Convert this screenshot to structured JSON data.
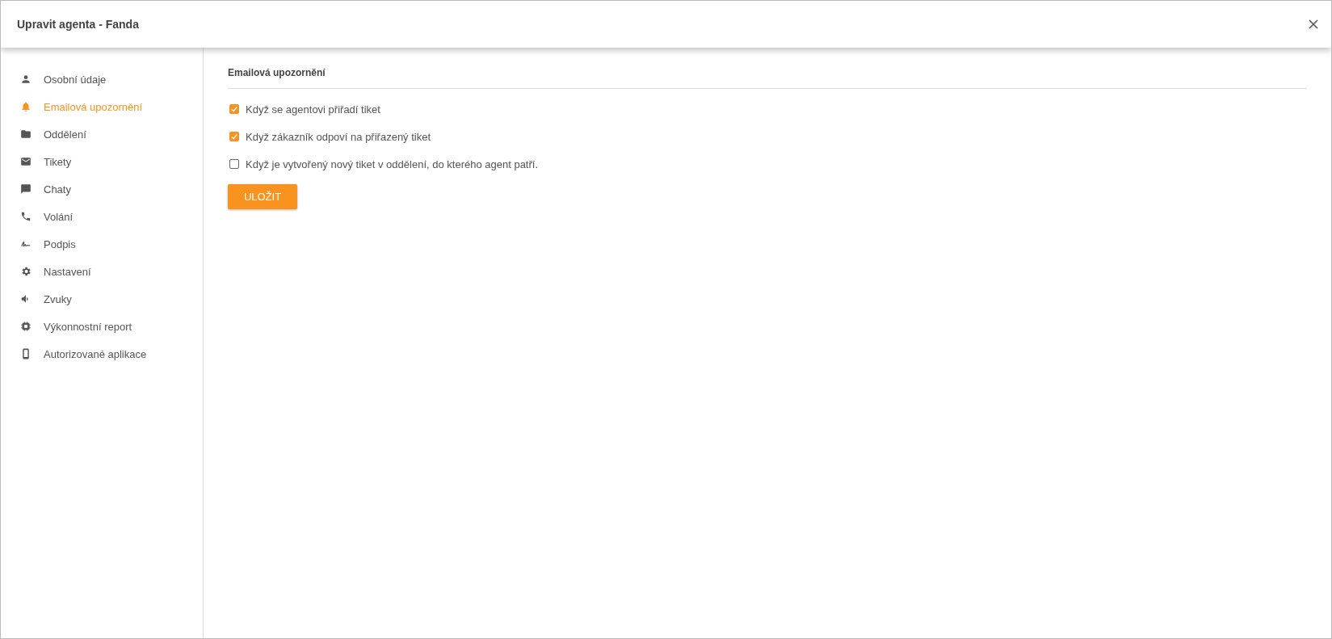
{
  "dialog": {
    "title": "Upravit agenta - Fanda"
  },
  "sidebar": {
    "items": [
      {
        "label": "Osobní údaje",
        "selected": false
      },
      {
        "label": "Emailová upozornění",
        "selected": true
      },
      {
        "label": "Oddělení",
        "selected": false
      },
      {
        "label": "Tikety",
        "selected": false
      },
      {
        "label": "Chaty",
        "selected": false
      },
      {
        "label": "Volání",
        "selected": false
      },
      {
        "label": "Podpis",
        "selected": false
      },
      {
        "label": "Nastavení",
        "selected": false
      },
      {
        "label": "Zvuky",
        "selected": false
      },
      {
        "label": "Výkonnostní report",
        "selected": false
      },
      {
        "label": "Autorizované aplikace",
        "selected": false
      }
    ]
  },
  "section": {
    "title": "Emailová upozornění",
    "options": [
      {
        "label": "Když se agentovi přiřadí tiket",
        "checked": true
      },
      {
        "label": "Když zákazník odpoví na přiřazený tiket",
        "checked": true
      },
      {
        "label": "Když je vytvořený nový tiket v oddělení, do kterého agent patří.",
        "checked": false
      }
    ],
    "save_button": "ULOŽIT"
  }
}
